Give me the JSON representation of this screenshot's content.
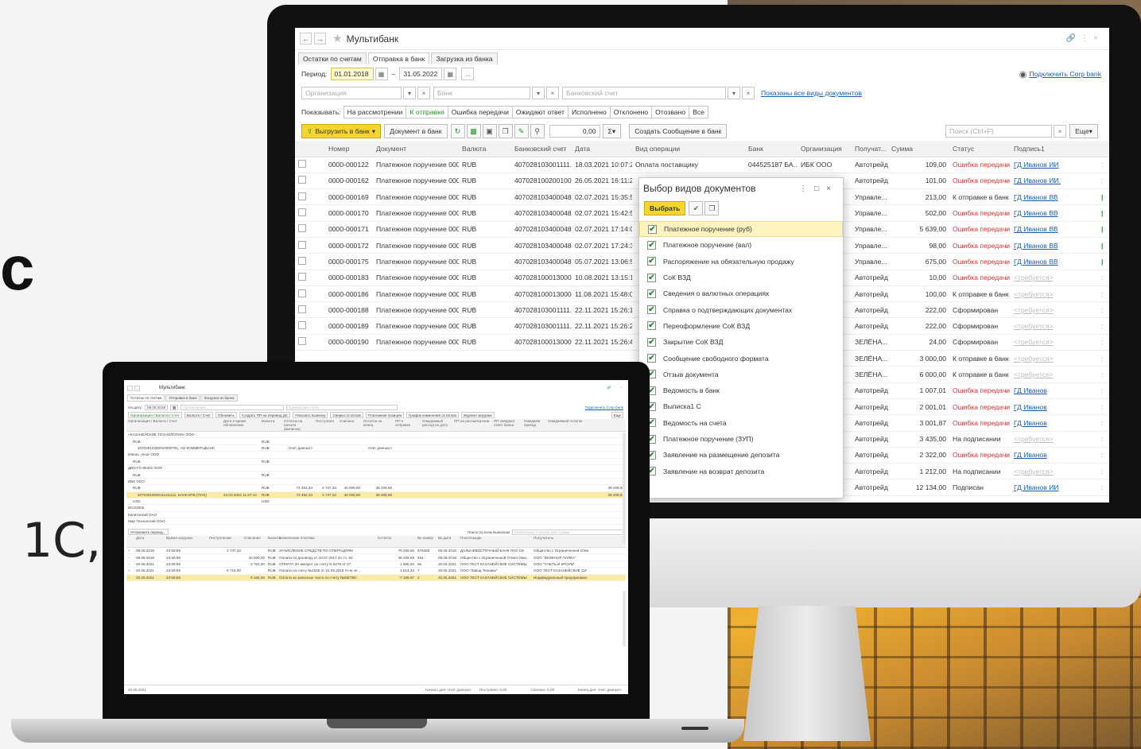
{
  "left_text": {
    "big": "с",
    "bottom": "1С,"
  },
  "colors": {
    "accent_yellow": "#f5d630",
    "error_red": "#e03030",
    "link_blue": "#1a5fb4",
    "positive_green": "#2a8f2a"
  },
  "monitor": {
    "title": "Мультибанк",
    "tabs": [
      "Остатки по счетам",
      "Отправка в банк",
      "Загрузка из банка"
    ],
    "active_tab": 1,
    "period_label": "Период:",
    "period_from": "01.01.2018",
    "period_dash": "–",
    "period_to": "31.05.2022",
    "more_btn": "...",
    "corp_bank_link": "Подключить Corp bank",
    "org_placeholder": "Организация",
    "bank_placeholder": "Банк",
    "account_placeholder": "Банковский счет",
    "doc_types_link": "Показаны все виды документов",
    "show_label": "Показывать:",
    "filters": [
      "На рассмотрении",
      "К отправке",
      "Ошибка передачи",
      "Ожидают ответ",
      "Исполнено",
      "Отклонено",
      "Отозвано",
      "Все"
    ],
    "active_filter": 1,
    "upload_btn": "Выгрузить в банк",
    "doc_to_bank_btn": "Документ в банк",
    "sum_value": "0,00",
    "sum_icon": "Σ",
    "create_msg_btn": "Создать Сообщение в банк",
    "search_placeholder": "Поиск (Ctrl+F)",
    "more_menu": "Еще",
    "columns": [
      "Номер",
      "Документ",
      "Валюта",
      "Банковский счет",
      "Дата",
      "Вид операции",
      "Банк",
      "Организация",
      "Получат...",
      "Сумма",
      "Статус",
      "Подпись1"
    ],
    "rows": [
      {
        "num": "0000-000122",
        "doc": "Платежное поручение 0000...",
        "cur": "RUB",
        "acc": "407028103001111...",
        "date": "18.03.2021 10:07:23",
        "op": "Оплата поставщику",
        "bank": "044525187 БА...",
        "org": "ИБК ООО",
        "rec": "Автотрейд",
        "sum": "109,00",
        "status": "Ошибка передачи",
        "sig": "ГД Иванов ИИ"
      },
      {
        "num": "0000-000162",
        "doc": "Платежное поручение 0000...",
        "cur": "RUB",
        "acc": "407028100200100...",
        "date": "26.05.2021 16:11:24",
        "op": "",
        "bank": "",
        "org": "",
        "rec": "Автотрейд",
        "sum": "101,00",
        "status": "Ошибка передачи",
        "sig": "ГД Иванов ИИ."
      },
      {
        "num": "0000-000169",
        "doc": "Платежное поручение 0000...",
        "cur": "RUB",
        "acc": "407028103400048...",
        "date": "02.07.2021 15:35:53",
        "op": "",
        "bank": "",
        "org": "",
        "rec": "Управле...",
        "sum": "213,00",
        "status": "К отправке в банк",
        "sig": "ГД Иванов ВВ"
      },
      {
        "num": "0000-000170",
        "doc": "Платежное поручение 0000...",
        "cur": "RUB",
        "acc": "407028103400048...",
        "date": "02.07.2021 15:42:56",
        "op": "",
        "bank": "",
        "org": "",
        "rec": "Управле...",
        "sum": "502,00",
        "status": "Ошибка передачи",
        "sig": "ГД Иванов ВВ"
      },
      {
        "num": "0000-000171",
        "doc": "Платежное поручение 0000...",
        "cur": "RUB",
        "acc": "407028103400048...",
        "date": "02.07.2021 17:14:05",
        "op": "",
        "bank": "",
        "org": "",
        "rec": "Управле...",
        "sum": "5 639,00",
        "status": "Ошибка передачи",
        "sig": "ГД Иванов ВВ"
      },
      {
        "num": "0000-000172",
        "doc": "Платежное поручение 0000...",
        "cur": "RUB",
        "acc": "407028103400048...",
        "date": "02.07.2021 17:24:38",
        "op": "",
        "bank": "",
        "org": "",
        "rec": "Управле...",
        "sum": "98,00",
        "status": "Ошибка передачи",
        "sig": "ГД Иванов ВВ"
      },
      {
        "num": "0000-000175",
        "doc": "Платежное поручение 0000...",
        "cur": "RUB",
        "acc": "407028103400048...",
        "date": "05.07.2021 13:06:53",
        "op": "",
        "bank": "",
        "org": "",
        "rec": "Управле...",
        "sum": "675,00",
        "status": "Ошибка передачи",
        "sig": "ГД Иванов ВВ"
      },
      {
        "num": "0000-000183",
        "doc": "Платежное поручение 0000...",
        "cur": "RUB",
        "acc": "407028100013000...",
        "date": "10.08.2021 13:15:16",
        "op": "",
        "bank": "",
        "org": "",
        "rec": "Автотрейд",
        "sum": "10,00",
        "status": "Ошибка передачи",
        "sig": "<требуется>"
      },
      {
        "num": "0000-000186",
        "doc": "Платежное поручение 0000...",
        "cur": "RUB",
        "acc": "407028100013000...",
        "date": "11.08.2021 15:48:03",
        "op": "",
        "bank": "",
        "org": "",
        "rec": "Автотрейд",
        "sum": "100,00",
        "status": "К отправке в банк",
        "sig": "<требуется>"
      },
      {
        "num": "0000-000188",
        "doc": "Платежное поручение 0000...",
        "cur": "RUB",
        "acc": "407028103001111...",
        "date": "22.11.2021 15:26:13",
        "op": "",
        "bank": "",
        "org": "",
        "rec": "Автотрейд",
        "sum": "222,00",
        "status": "Сформирован",
        "sig": "<требуется>"
      },
      {
        "num": "0000-000189",
        "doc": "Платежное поручение 0000...",
        "cur": "RUB",
        "acc": "407028103001111...",
        "date": "22.11.2021 15:26:22",
        "op": "",
        "bank": "",
        "org": "",
        "rec": "Автотрейд",
        "sum": "222,00",
        "status": "Сформирован",
        "sig": "<требуется>"
      },
      {
        "num": "0000-000190",
        "doc": "Платежное поручение 0000...",
        "cur": "RUB",
        "acc": "407028100013000...",
        "date": "22.11.2021 15:26:43",
        "op": "",
        "bank": "",
        "org": "",
        "rec": "ЗЕЛЁНА...",
        "sum": "24,00",
        "status": "Сформирован",
        "sig": "<требуется>"
      },
      {
        "num": "",
        "doc": "",
        "cur": "",
        "acc": "",
        "date": "",
        "op": "",
        "bank": "",
        "org": "",
        "rec": "ЗЕЛЁНА...",
        "sum": "3 000,00",
        "status": "К отправке в банк",
        "sig": "<требуется>"
      },
      {
        "num": "",
        "doc": "",
        "cur": "",
        "acc": "",
        "date": "",
        "op": "",
        "bank": "",
        "org": "",
        "rec": "ЗЕЛЁНА...",
        "sum": "6 000,00",
        "status": "К отправке в банк",
        "sig": "<требуется>"
      },
      {
        "num": "",
        "doc": "",
        "cur": "",
        "acc": "",
        "date": "",
        "op": "",
        "bank": "",
        "org": "",
        "rec": "Автотрейд",
        "sum": "1 007,01",
        "status": "Ошибка передачи",
        "sig": "ГД Иванов"
      },
      {
        "num": "",
        "doc": "",
        "cur": "",
        "acc": "",
        "date": "",
        "op": "",
        "bank": "",
        "org": "",
        "rec": "Автотрейд",
        "sum": "2 001,01",
        "status": "Ошибка передачи",
        "sig": "ГД Иванов"
      },
      {
        "num": "",
        "doc": "",
        "cur": "",
        "acc": "",
        "date": "",
        "op": "",
        "bank": "",
        "org": "",
        "rec": "Автотрейд",
        "sum": "3 001,87",
        "status": "Ошибка передачи",
        "sig": "ГД Иванов"
      },
      {
        "num": "",
        "doc": "",
        "cur": "",
        "acc": "",
        "date": "",
        "op": "",
        "bank": "",
        "org": "",
        "rec": "Автотрейд",
        "sum": "3 435,00",
        "status": "На подписании",
        "sig": "<требуется>"
      },
      {
        "num": "",
        "doc": "",
        "cur": "",
        "acc": "",
        "date": "",
        "op": "",
        "bank": "",
        "org": "",
        "rec": "Автотрейд",
        "sum": "2 322,00",
        "status": "Ошибка передачи",
        "sig": "ГД Иванов"
      },
      {
        "num": "",
        "doc": "",
        "cur": "",
        "acc": "",
        "date": "",
        "op": "",
        "bank": "",
        "org": "",
        "rec": "Автотрейд",
        "sum": "1 212,00",
        "status": "На подписании",
        "sig": "<требуется>"
      },
      {
        "num": "",
        "doc": "",
        "cur": "",
        "acc": "",
        "date": "",
        "op": "",
        "bank": "",
        "org": "",
        "rec": "Автотрейд",
        "sum": "12 134,00",
        "status": "Подписан",
        "sig": "ГД Иванов ИИ"
      }
    ],
    "dialog": {
      "title": "Выбор видов документов",
      "select_btn": "Выбрать",
      "items": [
        "Платежное поручение (руб)",
        "Платежное поручение (вал)",
        "Распоряжение на обязательную продажу",
        "СоК ВЗД",
        "Сведения о валютных операциях",
        "Справка о подтверждающих документах",
        "Переоформление СоК ВЗД",
        "Закрытие СоК ВЗД",
        "Сообщение свободного формата",
        "Отзыв документа",
        "Ведомость в банк",
        "Выписка1 С",
        "Ведомость на счета",
        "Платежное поручение (ЗУП)",
        "Заявление на размещение депозита",
        "Заявление на возврат депозита"
      ]
    }
  },
  "laptop": {
    "title": "Мультибанк",
    "tabs": [
      "Остатки по счетам",
      "Отправка в банк",
      "Загрузка из банка"
    ],
    "date_label": "На дату:",
    "date_value": "06.08.2018",
    "org_placeholder": "Организация",
    "account_placeholder": "Банковские счета",
    "corp_link": "Подключить Corp bank",
    "toolbar": [
      "Организация / Валюта / Счет",
      "Валюта / Счет",
      "Обновить",
      "Создать ПП на перевод ДС",
      "Показать выписку",
      "Сверка остатков",
      "Платежная позиция",
      "График изменения остатков",
      "Журнал загрузки"
    ],
    "more_menu": "Еще",
    "columns": [
      "Организация / Валюта / Счет",
      "Дата и время обновления",
      "Валюта",
      "Остаток на начало (выписка)",
      "Поступило",
      "Списано",
      "Остаток на конец",
      "ПП к отправке",
      "Ожидаемый расход на дату",
      "ПП на рассмотрении",
      "ПП ожидают ответ банка",
      "Ожидаем приход",
      "Ожидаемый остаток"
    ],
    "tree": [
      {
        "name": "«КАЗАНЕЙСКИЕ ТЕХНОЛОГИИ» ООО",
        "cur": "",
        "a": "",
        "b": "",
        "c": "",
        "d": "",
        "e": "",
        "hl": false
      },
      {
        "name": "RUB",
        "cur": "RUB",
        "a": "",
        "b": "",
        "c": "",
        "d": "",
        "e": "",
        "hl": false
      },
      {
        "name": "40702810200010000781, АО КОММЕРЦБАНК",
        "cur": "RUB",
        "a": "<Нет данных>",
        "b": "",
        "c": "",
        "d": "<Нет данных>",
        "e": "",
        "hl": false
      },
      {
        "name": "testuto_renar OOO",
        "cur": "",
        "a": "",
        "b": "",
        "c": "",
        "d": "",
        "e": "",
        "hl": false
      },
      {
        "name": "RUB",
        "cur": "RUB",
        "a": "",
        "b": "",
        "c": "",
        "d": "",
        "e": "",
        "hl": false
      },
      {
        "name": "ДВО-ГО-08401 ООО",
        "cur": "",
        "a": "",
        "b": "",
        "c": "",
        "d": "",
        "e": "",
        "hl": false
      },
      {
        "name": "RUB",
        "cur": "RUB",
        "a": "",
        "b": "",
        "c": "",
        "d": "",
        "e": "",
        "hl": false
      },
      {
        "name": "ИБК ООО",
        "cur": "",
        "a": "",
        "b": "",
        "c": "",
        "d": "",
        "e": "",
        "hl": false
      },
      {
        "name": "RUB",
        "cur": "RUB",
        "a": "74 462,33",
        "b": "4 747,33",
        "c": "40 000,00",
        "d": "39 209,66",
        "e": "39 209,66",
        "hl": false
      },
      {
        "name": "40702810000111111111, БАНК ВТБ (ПАО)",
        "cur": "RUB",
        "a": "74 462,33",
        "b": "4 747,33",
        "c": "40 000,00",
        "d": "39 209,66",
        "e": "39 209,66",
        "hl": true,
        "time": "24.03.2022 11:37:14"
      },
      {
        "name": "USD",
        "cur": "USD",
        "a": "",
        "b": "",
        "c": "",
        "d": "",
        "e": "",
        "hl": false
      },
      {
        "name": "ИСО2002",
        "cur": "",
        "a": "",
        "b": "",
        "c": "",
        "d": "",
        "e": "",
        "hl": false
      },
      {
        "name": "Капиталкой ОАО",
        "cur": "",
        "a": "",
        "b": "",
        "c": "",
        "d": "",
        "e": "",
        "hl": false
      },
      {
        "name": "Мир Технологий ООО",
        "cur": "",
        "a": "",
        "b": "",
        "c": "",
        "d": "",
        "e": "",
        "hl": false
      }
    ],
    "set_period_btn": "Установить период...",
    "search_all_label": "Поиск по всем выпискам",
    "search_all_placeholder": "Назначение платежа или Сумма",
    "tx_columns": [
      "Дата",
      "Время загрузки",
      "Поступление",
      "Списание",
      "Валюта",
      "Назначение платежа",
      "Остаток",
      "Вх.номер",
      "Вх.дата",
      "Плательщик",
      "Получатель"
    ],
    "tx_rows": [
      {
        "sign": "+",
        "date": "08.08.2018",
        "time": "23:59:59",
        "in": "4 747,33",
        "out": "",
        "cur": "RUB",
        "purpose": "ЗАЧИСЛЕНИЕ СРЕДСТВ ПО ОПЕРАЦИЯМ",
        "bal": "79 209,66",
        "no": "576483",
        "indate": "08.08.2018",
        "payer": "ДАЛЬНЕВОСТОЧНЫЙ БАНК ПАО СБ",
        "payee": "Общество с Ограниченной Отве",
        "hl": false
      },
      {
        "sign": "−",
        "date": "08.08.2018",
        "time": "23:59:59",
        "in": "",
        "out": "40 000,00",
        "cur": "RUB",
        "purpose": "Оплата по договору от 10.07.2017 по сч. 92",
        "bal": "39 209,66",
        "no": "491",
        "indate": "08.08.2018",
        "payer": "Общество с Ограниченной Ответствен...",
        "payee": "ООО \"ЗЕЛЕНАЯ ПАПКА\"",
        "hl": false
      },
      {
        "sign": "−",
        "date": "20.05.2021",
        "time": "23:59:59",
        "in": "",
        "out": "2 762,00",
        "cur": "RUB",
        "purpose": "ОПЛАТА ЗА аккаунт по счету N 5278 от 27",
        "bal": "1 885,33",
        "no": "55",
        "indate": "20.05.2021",
        "payer": "ООО ТЕСТ КАЗАНЕЙСКИЕ СИСТЕМЫ",
        "payee": "ООО \"СЧЕТЬ И КРОУМ\"",
        "hl": false
      },
      {
        "sign": "+",
        "date": "20.05.2021",
        "time": "23:59:59",
        "in": "6 715,00",
        "out": "",
        "cur": "RUB",
        "purpose": "Оплата по счету №1028 от 24.09.2016 Н на че...",
        "bal": "1 514,33",
        "no": "7",
        "indate": "20.05.2021",
        "payer": "ООО \"Завод Техники\"",
        "payee": "ООО ТЕСТ КАЗАНЕЙСКИЕ СИ",
        "hl": false
      },
      {
        "sign": "−",
        "date": "20.05.2021",
        "time": "23:59:59",
        "in": "",
        "out": "9 184,00",
        "cur": "RUB",
        "purpose": "Оплата за запасные части по счету №МЕТ8Н",
        "bal": "-7 186,67",
        "no": "2",
        "indate": "20.05.2021",
        "payer": "ООО ТЕСТ КАЗАНЕЙСКИЕ СИСТЕМЫ",
        "payee": "Индивидуальный предпринима",
        "hl": true
      }
    ],
    "footer_date": "20.05.2021",
    "footer_start": "Начало дня: <Нет данных>",
    "footer_in": "Поступило: 0,00",
    "footer_out": "Списано: 0,00",
    "footer_end": "Конец дня: <Нет данных>"
  }
}
